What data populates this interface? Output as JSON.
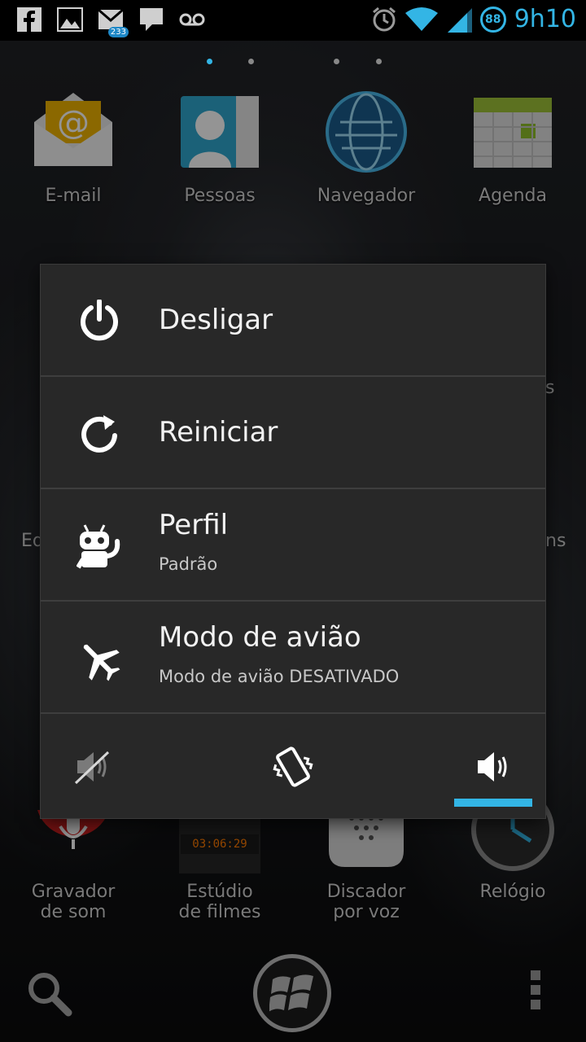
{
  "statusbar": {
    "time": "9h10",
    "battery_level": "88",
    "mail_badge": "233",
    "left_icons": [
      "facebook-icon",
      "gallery-icon",
      "gmail-icon",
      "message-icon",
      "voicemail-icon"
    ],
    "right_icons": [
      "alarm-icon",
      "wifi-icon",
      "signal-icon"
    ]
  },
  "homescreen": {
    "row1": [
      {
        "label": "E-mail",
        "icon": "email-icon"
      },
      {
        "label": "Pessoas",
        "icon": "people-icon"
      },
      {
        "label": "Navegador",
        "icon": "browser-icon"
      },
      {
        "label": "Agenda",
        "icon": "calendar-icon"
      }
    ],
    "row4": [
      {
        "label_line1": "Gravador",
        "label_line2": "de som",
        "icon": "sound-recorder-icon"
      },
      {
        "label_line1": "Estúdio",
        "label_line2": "de filmes",
        "icon": "movie-studio-icon",
        "clock_text": "03:06:29"
      },
      {
        "label_line1": "Discador",
        "label_line2": "por voz",
        "icon": "voice-dialer-icon"
      },
      {
        "label_line1": "Relógio",
        "label_line2": "",
        "icon": "clock-icon"
      }
    ],
    "partial_labels": {
      "left": "Eq",
      "right": "ns",
      "right_s": "s"
    }
  },
  "power_menu": {
    "items": [
      {
        "title": "Desligar",
        "subtitle": "",
        "icon": "power-icon"
      },
      {
        "title": "Reiniciar",
        "subtitle": "",
        "icon": "reboot-icon"
      },
      {
        "title": "Perfil",
        "subtitle": "Padrão",
        "icon": "cyanogen-android-icon"
      },
      {
        "title": "Modo de avião",
        "subtitle": "Modo de avião DESATIVADO",
        "icon": "airplane-icon"
      }
    ],
    "sound_modes": [
      {
        "name": "silent",
        "icon": "sound-muted-icon",
        "active": false
      },
      {
        "name": "vibrate",
        "icon": "vibrate-icon",
        "active": false
      },
      {
        "name": "sound-on",
        "icon": "sound-on-icon",
        "active": true
      }
    ],
    "accent_color": "#33b5e5"
  },
  "dock": {
    "icons": [
      "search-icon",
      "home-button-icon",
      "menu-icon"
    ]
  }
}
